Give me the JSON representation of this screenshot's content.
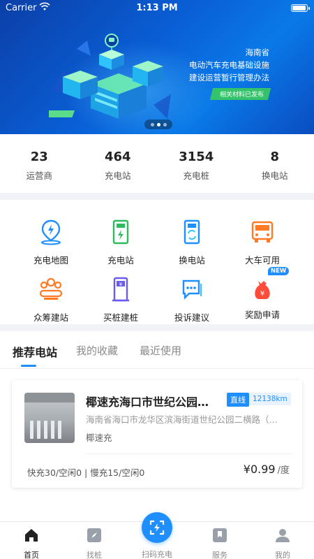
{
  "status_bar": {
    "carrier": "Carrier",
    "time": "1:13 PM"
  },
  "banner": {
    "lines": [
      "海南省",
      "电动汽车充电基础设施",
      "建设运营暂行管理办法"
    ],
    "badge": "相关材料已发布",
    "page_count": 3,
    "active_page": 1
  },
  "stats": [
    {
      "value": "23",
      "label": "运营商"
    },
    {
      "value": "464",
      "label": "充电站"
    },
    {
      "value": "3154",
      "label": "充电桩"
    },
    {
      "value": "8",
      "label": "换电站"
    }
  ],
  "services": [
    {
      "label": "充电地图",
      "icon": "map-pin-icon",
      "color": "#1f8fff"
    },
    {
      "label": "充电站",
      "icon": "charging-pile-icon",
      "color": "#2dbb5d"
    },
    {
      "label": "换电站",
      "icon": "battery-swap-icon",
      "color": "#1f8fff"
    },
    {
      "label": "大车可用",
      "icon": "truck-icon",
      "color": "#ff7a24"
    },
    {
      "label": "众筹建站",
      "icon": "group-icon",
      "color": "#ff7a24"
    },
    {
      "label": "买桩建桩",
      "icon": "buy-pile-icon",
      "color": "#6a5cf0"
    },
    {
      "label": "投诉建议",
      "icon": "chat-icon",
      "color": "#1f8fff"
    },
    {
      "label": "奖励申请",
      "icon": "money-bag-icon",
      "color": "#ff4b3a",
      "badge": "NEW"
    }
  ],
  "tabs": [
    {
      "label": "推荐电站",
      "active": true
    },
    {
      "label": "我的收藏",
      "active": false
    },
    {
      "label": "最近使用",
      "active": false
    }
  ],
  "station": {
    "name": "椰速充海口市世纪公园…",
    "tag": "直线",
    "distance": "12138km",
    "address": "海南省海口市龙华区滨海街道世纪公园二横路（…",
    "operator": "椰速充",
    "availability": "快充30/空闲0 | 慢充15/空闲0",
    "price": "¥0.99",
    "price_unit": "/度"
  },
  "nav": [
    {
      "label": "首页",
      "icon": "home-icon",
      "active": true
    },
    {
      "label": "找桩",
      "icon": "compass-icon",
      "active": false
    },
    {
      "label": "扫码充电",
      "icon": "scan-icon",
      "active": false
    },
    {
      "label": "服务",
      "icon": "bookmark-icon",
      "active": false
    },
    {
      "label": "我的",
      "icon": "user-icon",
      "active": false
    }
  ],
  "colors": {
    "accent": "#1f8fff",
    "green": "#2dbb5d",
    "orange": "#ff7a24",
    "purple": "#6a5cf0"
  }
}
